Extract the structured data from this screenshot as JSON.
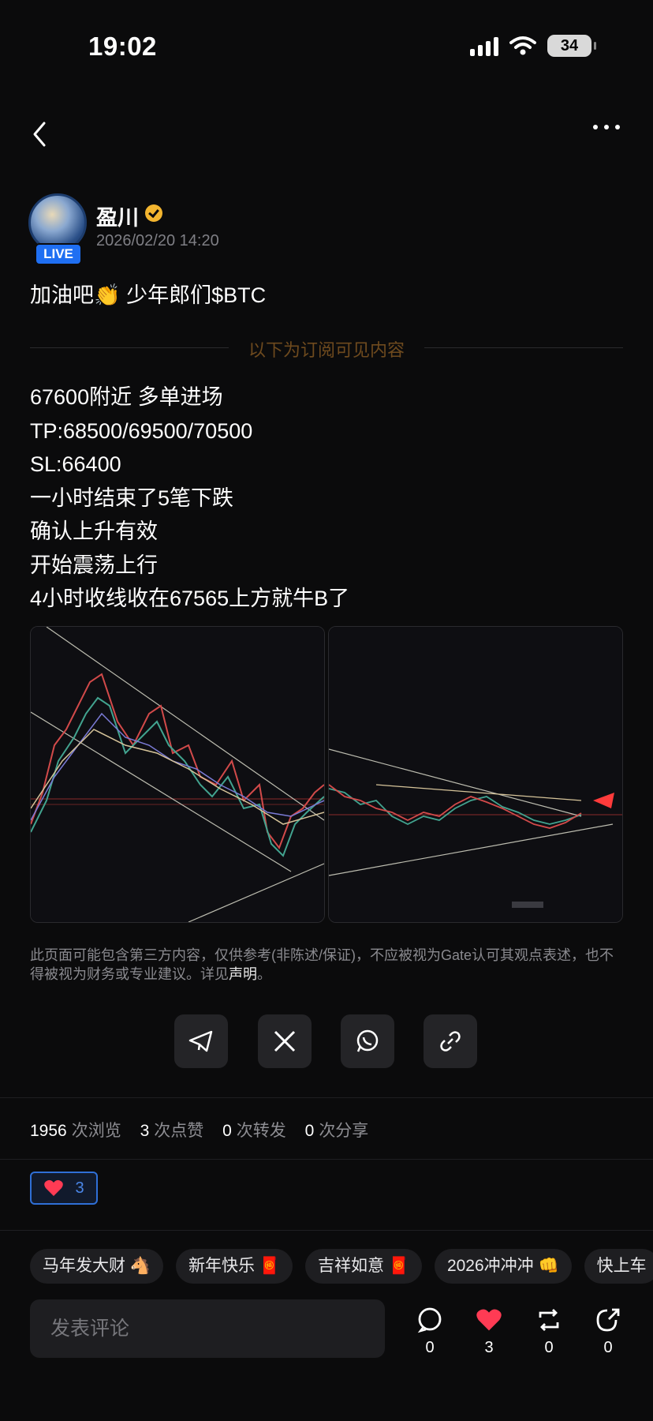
{
  "status": {
    "time": "19:02",
    "battery": "34"
  },
  "post": {
    "author": "盈川",
    "live_badge": "LIVE",
    "date": "2026/02/20 14:20",
    "headline": "加油吧👏 少年郎们$BTC",
    "subscriber_label": "以下为订阅可见内容",
    "lines": [
      "67600附近 多单进场",
      "TP:68500/69500/70500",
      "SL:66400",
      "一小时结束了5笔下跌",
      "确认上升有效",
      "开始震荡上行",
      "4小时收线收在67565上方就牛B了"
    ],
    "disclaimer": "此页面可能包含第三方内容，仅供参考(非陈述/保证)，不应被视为Gate认可其观点表述，也不得被视为财务或专业建议。详见",
    "disclaimer_link": "声明",
    "disclaimer_end": "。"
  },
  "stats": {
    "views": "1956",
    "views_label": "次浏览",
    "likes": "3",
    "likes_label": "次点赞",
    "reposts": "0",
    "reposts_label": "次转发",
    "shares": "0",
    "shares_label": "次分享"
  },
  "reaction": {
    "count": "3"
  },
  "tags": [
    "马年发大财 🐴",
    "新年快乐 🧧",
    "吉祥如意 🧧",
    "2026冲冲冲 👊",
    "快上车"
  ],
  "comment": {
    "placeholder": "发表评论"
  },
  "actions": {
    "comments": "0",
    "likes": "3",
    "reposts": "0",
    "shares": "0"
  },
  "colors": {
    "accent": "#1f6ff2",
    "like_red": "#ff3b54",
    "gold_label": "#6e4a1e",
    "verified": "#f3b52f"
  }
}
